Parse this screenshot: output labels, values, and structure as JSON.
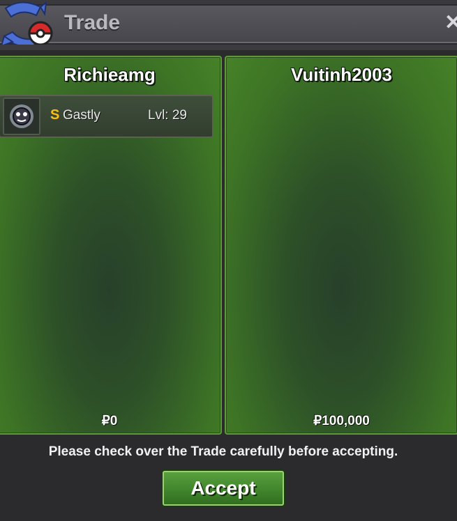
{
  "window": {
    "title": "Trade",
    "close_icon": "close-icon"
  },
  "left_player": {
    "name": "Richieamg",
    "pokemon": [
      {
        "shiny_badge": "S",
        "name": "Gastly",
        "level": "Lvl: 29"
      }
    ],
    "money": "₽0"
  },
  "right_player": {
    "name": "Vuitinh2003",
    "money": "₽100,000"
  },
  "footer": {
    "notice": "Please check over the Trade carefully before accepting.",
    "accept_label": "Accept"
  },
  "colors": {
    "panel_green": "#3d7425",
    "accept_green": "#4a8f34",
    "background": "#2b2b2e",
    "shiny_gold": "#f3c21a"
  }
}
